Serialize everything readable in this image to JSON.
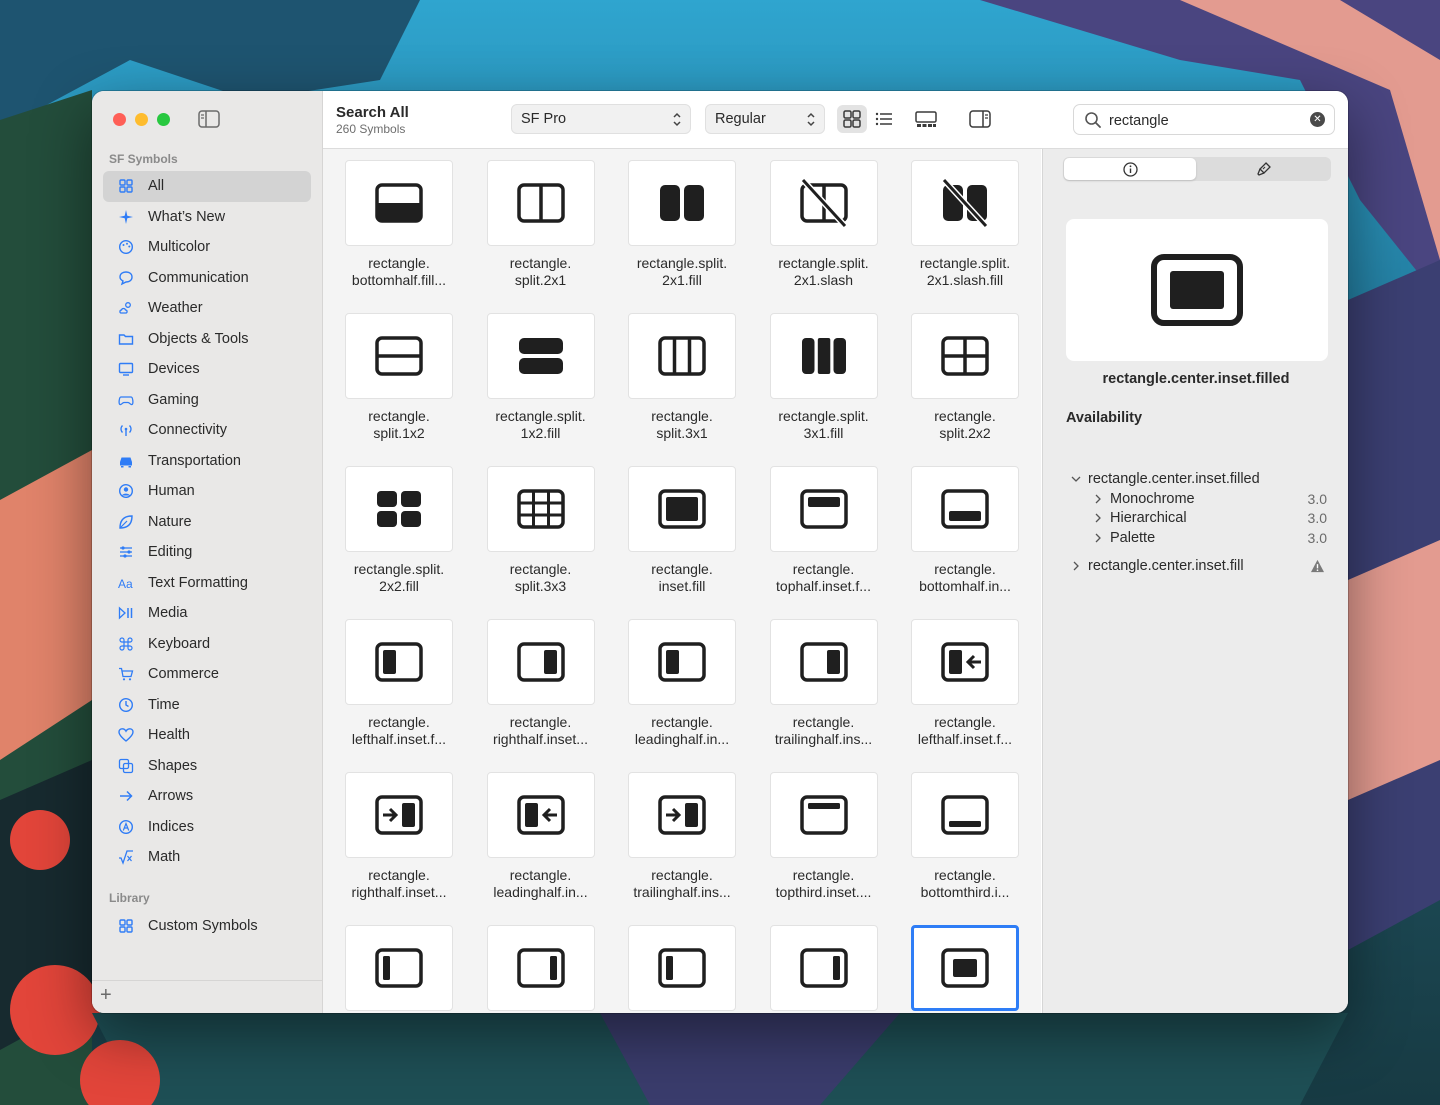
{
  "window": {
    "sidebar": {
      "section_label": "SF Symbols",
      "items": [
        {
          "label": "All",
          "icon": "grid-icon",
          "selected": true
        },
        {
          "label": "What’s New",
          "icon": "sparkle-icon"
        },
        {
          "label": "Multicolor",
          "icon": "palette-icon"
        },
        {
          "label": "Communication",
          "icon": "bubble-icon"
        },
        {
          "label": "Weather",
          "icon": "cloud-sun-icon"
        },
        {
          "label": "Objects & Tools",
          "icon": "folder-icon"
        },
        {
          "label": "Devices",
          "icon": "display-icon"
        },
        {
          "label": "Gaming",
          "icon": "gamecontroller-icon"
        },
        {
          "label": "Connectivity",
          "icon": "antenna-icon"
        },
        {
          "label": "Transportation",
          "icon": "car-icon"
        },
        {
          "label": "Human",
          "icon": "person-circle-icon"
        },
        {
          "label": "Nature",
          "icon": "leaf-icon"
        },
        {
          "label": "Editing",
          "icon": "sliders-icon"
        },
        {
          "label": "Text Formatting",
          "icon": "textformat-icon"
        },
        {
          "label": "Media",
          "icon": "playpause-icon"
        },
        {
          "label": "Keyboard",
          "icon": "command-icon"
        },
        {
          "label": "Commerce",
          "icon": "cart-icon"
        },
        {
          "label": "Time",
          "icon": "clock-icon"
        },
        {
          "label": "Health",
          "icon": "heart-icon"
        },
        {
          "label": "Shapes",
          "icon": "squares-icon"
        },
        {
          "label": "Arrows",
          "icon": "arrow-right-icon"
        },
        {
          "label": "Indices",
          "icon": "a-circle-icon"
        },
        {
          "label": "Math",
          "icon": "sqrt-icon"
        }
      ],
      "library_label": "Library",
      "library_items": [
        {
          "label": "Custom Symbols",
          "icon": "grid-icon"
        }
      ],
      "add_label": "+"
    },
    "toolbar": {
      "title": "Search All",
      "subtitle": "260 Symbols",
      "font_popup": "SF Pro",
      "weight_popup": "Regular",
      "search_value": "rectangle",
      "search_clear": "✕"
    },
    "grid": [
      {
        "label": "rectangle.\nbottomhalf.fill...",
        "glyph": "bottomhalf-fill"
      },
      {
        "label": "rectangle.\nsplit.2x1",
        "glyph": "split-2x1"
      },
      {
        "label": "rectangle.split.\n2x1.fill",
        "glyph": "split-2x1-fill"
      },
      {
        "label": "rectangle.split.\n2x1.slash",
        "glyph": "split-2x1-slash"
      },
      {
        "label": "rectangle.split.\n2x1.slash.fill",
        "glyph": "split-2x1-slash-fill"
      },
      {
        "label": "rectangle.\nsplit.1x2",
        "glyph": "split-1x2"
      },
      {
        "label": "rectangle.split.\n1x2.fill",
        "glyph": "split-1x2-fill"
      },
      {
        "label": "rectangle.\nsplit.3x1",
        "glyph": "split-3x1"
      },
      {
        "label": "rectangle.split.\n3x1.fill",
        "glyph": "split-3x1-fill"
      },
      {
        "label": "rectangle.\nsplit.2x2",
        "glyph": "split-2x2"
      },
      {
        "label": "rectangle.split.\n2x2.fill",
        "glyph": "split-2x2-fill"
      },
      {
        "label": "rectangle.\nsplit.3x3",
        "glyph": "split-3x3"
      },
      {
        "label": "rectangle.\ninset.fill",
        "glyph": "inset-fill"
      },
      {
        "label": "rectangle.\ntophalf.inset.f...",
        "glyph": "tophalf-inset"
      },
      {
        "label": "rectangle.\nbottomhalf.in...",
        "glyph": "bottomhalf-inset"
      },
      {
        "label": "rectangle.\nlefthalf.inset.f...",
        "glyph": "lefthalf-inset"
      },
      {
        "label": "rectangle.\nrighthalf.inset...",
        "glyph": "righthalf-inset"
      },
      {
        "label": "rectangle.\nleadinghalf.in...",
        "glyph": "lefthalf-inset"
      },
      {
        "label": "rectangle.\ntrailinghalf.ins...",
        "glyph": "righthalf-inset"
      },
      {
        "label": "rectangle.\nlefthalf.inset.f...",
        "glyph": "lefthalf-arrow-left"
      },
      {
        "label": "rectangle.\nrighthalf.inset...",
        "glyph": "righthalf-arrow-right"
      },
      {
        "label": "rectangle.\nleadinghalf.in...",
        "glyph": "lefthalf-arrow-left"
      },
      {
        "label": "rectangle.\ntrailinghalf.ins...",
        "glyph": "righthalf-arrow-right"
      },
      {
        "label": "rectangle.\ntopthird.inset....",
        "glyph": "topthird-inset"
      },
      {
        "label": "rectangle.\nbottomthird.i...",
        "glyph": "bottomthird-inset"
      },
      {
        "label": "",
        "glyph": "leftthird-inset"
      },
      {
        "label": "",
        "glyph": "rightthird-inset"
      },
      {
        "label": "",
        "glyph": "leftthird-inset"
      },
      {
        "label": "",
        "glyph": "rightthird-inset"
      },
      {
        "label": "",
        "glyph": "center-inset",
        "selected": true
      }
    ],
    "inspector": {
      "tab_info_icon": "info-icon",
      "tab_paint_icon": "paintbrush-icon",
      "symbol_name": "rectangle.center.inset.filled",
      "availability_title": "Availability",
      "tree": [
        {
          "label": "rectangle.center.inset.filled",
          "level": 0,
          "expanded": true
        },
        {
          "label": "Monochrome",
          "level": 1,
          "version": "3.0"
        },
        {
          "label": "Hierarchical",
          "level": 1,
          "version": "3.0"
        },
        {
          "label": "Palette",
          "level": 1,
          "version": "3.0"
        },
        {
          "label": "rectangle.center.inset.fill",
          "level": 0,
          "expanded": false,
          "warning": true
        }
      ]
    }
  },
  "colors": {
    "accent": "#2e7df6",
    "sidebar_bg": "#e9e8e7",
    "grid_bg": "#f4f4f4",
    "inspector_bg": "#ececec"
  }
}
